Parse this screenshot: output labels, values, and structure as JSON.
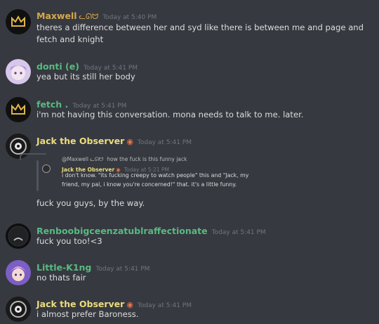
{
  "colors": {
    "background": "#36393f",
    "maxwell": "#d6a84e",
    "green": "#59b982",
    "yellow": "#eddc7f",
    "timestamp": "#72767d",
    "text": "#dcddde"
  },
  "messages": [
    {
      "author": "Maxwell",
      "badge": "ᓚᘏᗢ",
      "time": "Today at 5:40 PM",
      "lines": [
        "theres a difference between her and syd like there is between me and page and",
        "fetch and knight"
      ],
      "avatar_icon": "crown-icon"
    },
    {
      "author": "donti (e)",
      "time": "Today at 5:41 PM",
      "text": "yea but its still her body",
      "avatar_icon": "anime-character-icon"
    },
    {
      "author": "fetch .",
      "time": "Today at 5:41 PM",
      "text": "i'm not having this conversation. mona needs to talk to me. later.",
      "avatar_icon": "crown-icon"
    },
    {
      "author": "Jack the Observer",
      "badge": "◉",
      "time": "Today at 5:41 PM",
      "reply": {
        "author": "@Maxwell ᓚᘏᗢ",
        "text": "how the fuck is this funny jack"
      },
      "quote": {
        "author": "Jack the Observer",
        "badge": "◉",
        "time": "Today at 5:21 PM",
        "lines": [
          "i don't know. \"its fucking creepy to watch people\" this and \"Jack, my",
          "friend, my pal, i know you're concerned!\" that. it's a little funny."
        ]
      },
      "text": "fuck you guys, by the way.",
      "avatar_icon": "mechanical-eye-icon"
    },
    {
      "author": "Renboobigceenzatublraffectionate",
      "time": "Today at 5:41 PM",
      "text": "fuck you too!<3",
      "avatar_icon": "sad-face-icon"
    },
    {
      "author": "Little-K1ng",
      "time": "Today at 5:41 PM",
      "text": "no thats fair",
      "avatar_icon": "anime-character-icon"
    },
    {
      "author": "Jack the Observer",
      "badge": "◉",
      "time": "Today at 5:41 PM",
      "text": "i almost prefer Baroness.",
      "avatar_icon": "mechanical-eye-icon"
    }
  ]
}
